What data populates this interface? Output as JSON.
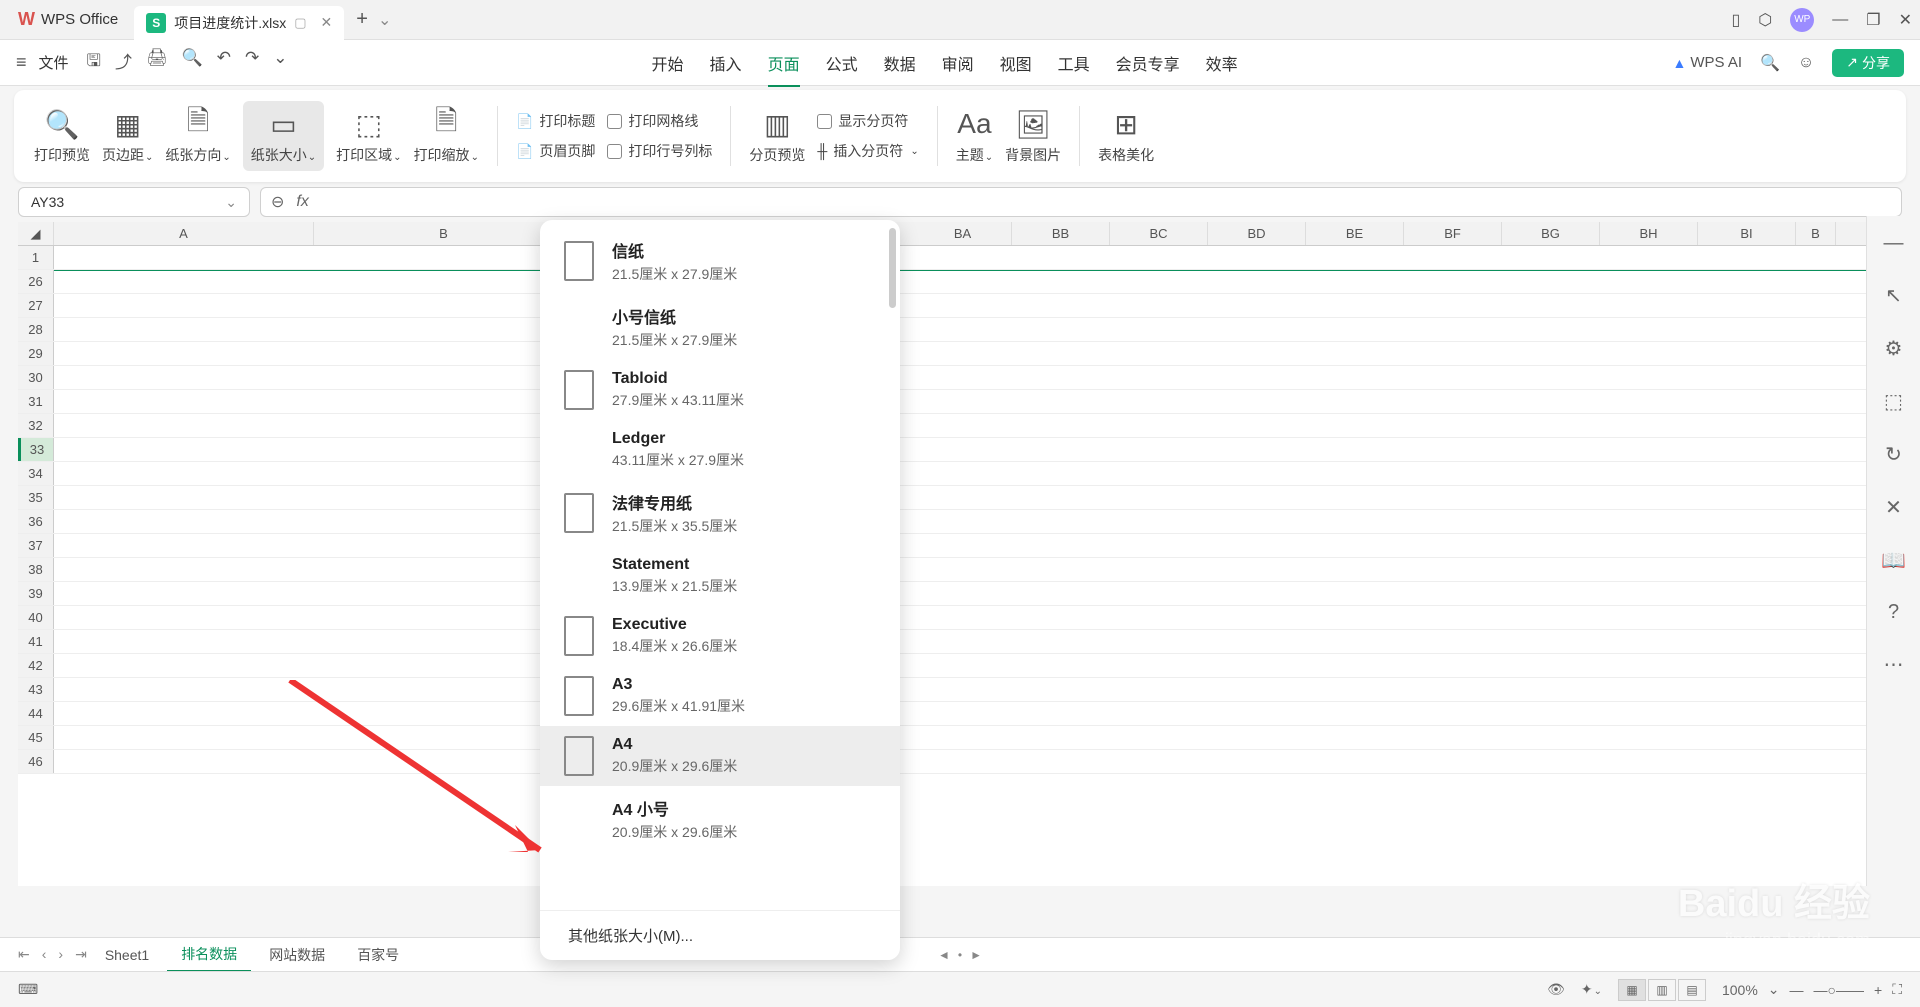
{
  "titlebar": {
    "app_name": "WPS Office",
    "file_name": "项目进度统计.xlsx",
    "file_badge": "S",
    "add": "+"
  },
  "menubar": {
    "file": "文件",
    "tabs": [
      "开始",
      "插入",
      "页面",
      "公式",
      "数据",
      "审阅",
      "视图",
      "工具",
      "会员专享",
      "效率"
    ],
    "active_tab": "页面",
    "ai": "WPS AI",
    "share": "分享"
  },
  "ribbon": {
    "print_preview": "打印预览",
    "margins": "页边距",
    "orientation": "纸张方向",
    "paper_size": "纸张大小",
    "print_area": "打印区域",
    "print_scale": "打印缩放",
    "print_title": "打印标题",
    "print_grid": "打印网格线",
    "header_footer": "页眉页脚",
    "row_col_label": "打印行号列标",
    "page_break_preview": "分页预览",
    "show_page_break": "显示分页符",
    "insert_page_break": "插入分页符",
    "theme": "主题",
    "bg_image": "背景图片",
    "table_beautify": "表格美化"
  },
  "namebox": {
    "value": "AY33"
  },
  "formula": {
    "label": "fx"
  },
  "columns_left": [
    "A",
    "B"
  ],
  "columns_right": [
    "BA",
    "BB",
    "BC",
    "BD",
    "BE",
    "BF",
    "BG",
    "BH",
    "BI",
    "B"
  ],
  "rows_visible": [
    "1",
    "26",
    "27",
    "28",
    "29",
    "30",
    "31",
    "32",
    "33",
    "34",
    "35",
    "36",
    "37",
    "38",
    "39",
    "40",
    "41",
    "42",
    "43",
    "44",
    "45",
    "46"
  ],
  "selected_row": "33",
  "paper_sizes": [
    {
      "name": "信纸",
      "size": "21.5厘米 x 27.9厘米",
      "icon": true
    },
    {
      "name": "小号信纸",
      "size": "21.5厘米 x 27.9厘米",
      "icon": false
    },
    {
      "name": "Tabloid",
      "size": "27.9厘米 x 43.11厘米",
      "icon": true
    },
    {
      "name": "Ledger",
      "size": "43.11厘米 x 27.9厘米",
      "icon": false
    },
    {
      "name": "法律专用纸",
      "size": "21.5厘米 x 35.5厘米",
      "icon": true
    },
    {
      "name": "Statement",
      "size": "13.9厘米 x 21.5厘米",
      "icon": false
    },
    {
      "name": "Executive",
      "size": "18.4厘米 x 26.6厘米",
      "icon": true
    },
    {
      "name": "A3",
      "size": "29.6厘米 x 41.91厘米",
      "icon": true
    },
    {
      "name": "A4",
      "size": "20.9厘米 x 29.6厘米",
      "icon": true,
      "hover": true
    },
    {
      "name": "A4 小号",
      "size": "20.9厘米 x 29.6厘米",
      "icon": false
    }
  ],
  "paper_footer": "其他纸张大小(M)...",
  "sheet_tabs": [
    "Sheet1",
    "排名数据",
    "网站数据",
    "百家号"
  ],
  "active_sheet_tab": "排名数据",
  "zoom": "100%",
  "watermark1": "Baidu 经验",
  "watermark2": "jingyan.baidu.com"
}
